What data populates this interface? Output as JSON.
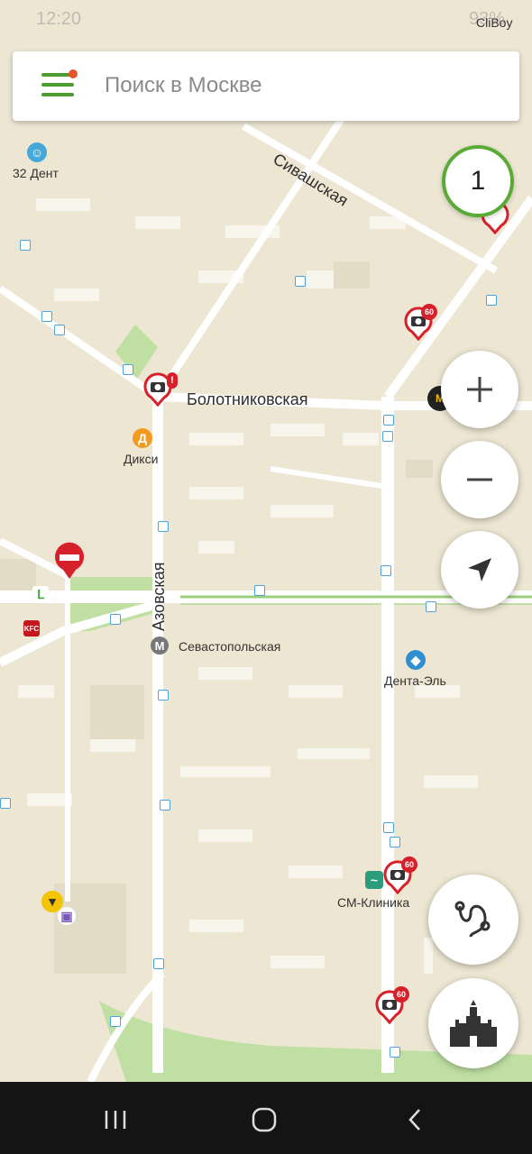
{
  "status_bar": {
    "time": "12:20",
    "battery": "93%",
    "corner_label": "CliBoy"
  },
  "search": {
    "placeholder": "Поиск в Москве"
  },
  "counter_badge": "1",
  "streets": {
    "sivashskaya": "Сивашская",
    "bolotnikovskaya": "Болотниковская",
    "azovskaya": "Азовская"
  },
  "poi": {
    "dent32": "32 Дент",
    "diksi": "Дикси",
    "sevastopolskaya": "Севастопольская",
    "denta_el": "Дента-Эль",
    "sm_clinic": "СМ-Клиника"
  },
  "camera_speed_limit": "60",
  "icons": {
    "menu": "hamburger-icon",
    "zoom_in": "plus-icon",
    "zoom_out": "minus-icon",
    "locate": "navigation-arrow-icon",
    "route": "route-icon",
    "kremlin": "kremlin-icon",
    "no_entry": "no-entry-icon"
  },
  "colors": {
    "accent": "#4a9d2e",
    "camera": "#d6202a",
    "map_bg": "#ece6d2"
  }
}
